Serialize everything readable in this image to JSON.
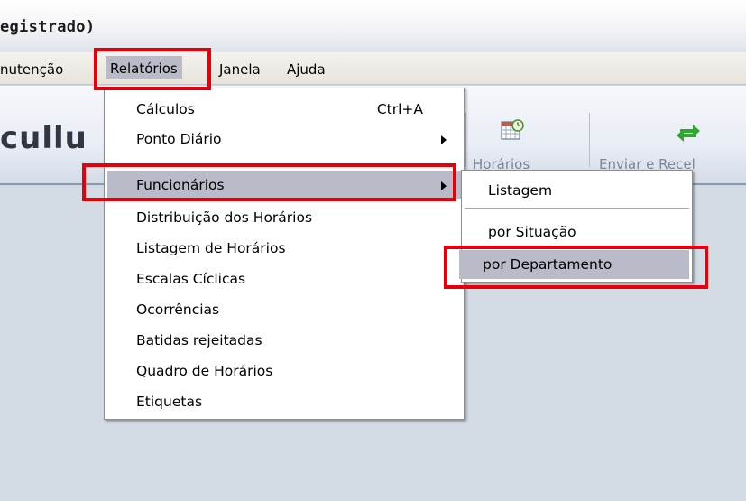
{
  "window": {
    "title": "egistrado)"
  },
  "menubar": {
    "items": [
      {
        "label": "nutenção"
      },
      {
        "label": "Relatórios"
      },
      {
        "label": "Janela"
      },
      {
        "label": "Ajuda"
      }
    ]
  },
  "toolbar": {
    "brand": "cullu",
    "tools": [
      {
        "label": "Horários",
        "icon": "calendar-icon"
      },
      {
        "label": "Enviar e Recel",
        "icon": "sync-icon"
      }
    ]
  },
  "relatorios_menu": {
    "items": [
      {
        "label": "Cálculos",
        "shortcut": "Ctrl+A"
      },
      {
        "label": "Ponto Diário",
        "submenu": true
      },
      {
        "label": "Funcionários",
        "submenu": true,
        "highlighted": true
      },
      {
        "label": "Distribuição dos Horários"
      },
      {
        "label": "Listagem de Horários"
      },
      {
        "label": "Escalas Cíclicas"
      },
      {
        "label": "Ocorrências"
      },
      {
        "label": "Batidas rejeitadas"
      },
      {
        "label": "Quadro de Horários"
      },
      {
        "label": "Etiquetas"
      }
    ]
  },
  "funcionarios_submenu": {
    "items": [
      {
        "label": "Listagem"
      },
      {
        "label": "por Situação"
      },
      {
        "label": "por Departamento",
        "highlighted": true
      }
    ]
  },
  "colors": {
    "highlight": "#b9bcc8",
    "annotation_red": "#e5000a",
    "workspace": "#d3dbe5"
  }
}
